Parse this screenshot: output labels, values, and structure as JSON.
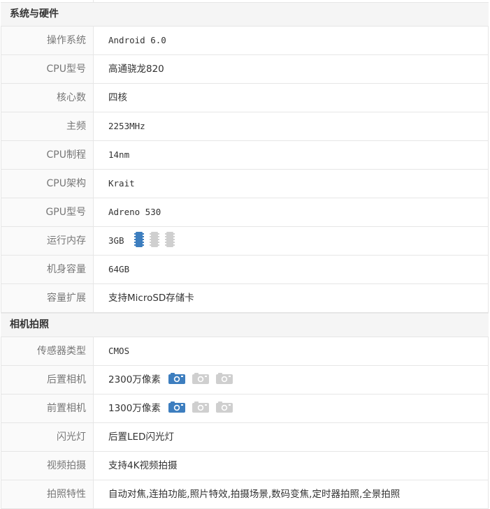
{
  "sections": [
    {
      "title": "系统与硬件",
      "rows": [
        {
          "label": "操作系统",
          "value": "Android 6.0"
        },
        {
          "label": "CPU型号",
          "value": "高通骁龙820"
        },
        {
          "label": "核心数",
          "value": "四核"
        },
        {
          "label": "主频",
          "value": "2253MHz"
        },
        {
          "label": "CPU制程",
          "value": "14nm"
        },
        {
          "label": "CPU架构",
          "value": "Krait"
        },
        {
          "label": "GPU型号",
          "value": "Adreno 530"
        },
        {
          "label": "运行内存",
          "value": "3GB",
          "rating_icon": "memory-chip-icon",
          "rating_level": 1,
          "rating_max": 3
        },
        {
          "label": "机身容量",
          "value": "64GB"
        },
        {
          "label": "容量扩展",
          "value": "支持MicroSD存储卡"
        }
      ]
    },
    {
      "title": "相机拍照",
      "rows": [
        {
          "label": "传感器类型",
          "value": "CMOS"
        },
        {
          "label": "后置相机",
          "value": "2300万像素",
          "rating_icon": "camera-icon",
          "rating_level": 1,
          "rating_max": 3
        },
        {
          "label": "前置相机",
          "value": "1300万像素",
          "rating_icon": "camera-icon",
          "rating_level": 1,
          "rating_max": 3
        },
        {
          "label": "闪光灯",
          "value": "后置LED闪光灯"
        },
        {
          "label": "视频拍摄",
          "value": "支持4K视频拍摄"
        },
        {
          "label": "拍照特性",
          "value": "自动对焦,连拍功能,照片特效,拍摄场景,数码变焦,定时器拍照,全景拍照"
        }
      ]
    }
  ],
  "colors": {
    "active_icon": "#3d7ebf",
    "inactive_icon": "#cfcfcf",
    "section_bg": "#f5f5f5",
    "label_bg": "#fafafa",
    "border": "#e6e6e6"
  }
}
